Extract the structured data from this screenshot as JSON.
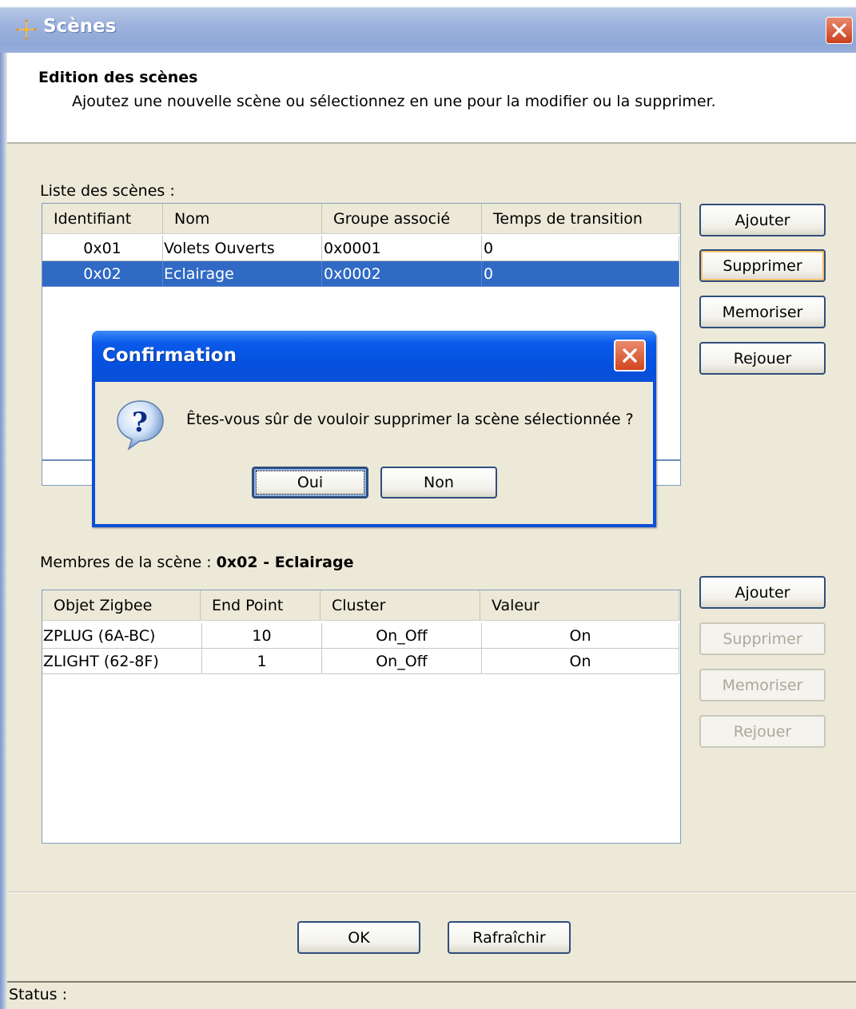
{
  "window": {
    "title": "Scènes",
    "close_icon": "close-icon"
  },
  "header": {
    "title": "Edition des scènes",
    "description": "Ajoutez une nouvelle scène ou sélectionnez en une pour la modifier ou la supprimer."
  },
  "scenes": {
    "label": "Liste des scènes :",
    "columns": [
      "Identifiant",
      "Nom",
      "Groupe associé",
      "Temps de transition"
    ],
    "rows": [
      {
        "id": "0x01",
        "name": "Volets Ouverts",
        "group": "0x0001",
        "transition": "0",
        "selected": false
      },
      {
        "id": "0x02",
        "name": "Eclairage",
        "group": "0x0002",
        "transition": "0",
        "selected": true
      }
    ],
    "buttons": {
      "add": "Ajouter",
      "delete": "Supprimer",
      "store": "Memoriser",
      "replay": "Rejouer"
    }
  },
  "members": {
    "label_prefix": "Membres de la scène : ",
    "label_scene": "0x02 - Eclairage",
    "columns": [
      "Objet Zigbee",
      "End Point",
      "Cluster",
      "Valeur"
    ],
    "rows": [
      {
        "object": "ZPLUG (6A-BC)",
        "endpoint": "10",
        "cluster": "On_Off",
        "value": "On"
      },
      {
        "object": "ZLIGHT (62-8F)",
        "endpoint": "1",
        "cluster": "On_Off",
        "value": "On"
      }
    ],
    "buttons": {
      "add": "Ajouter",
      "delete": "Supprimer",
      "store": "Memoriser",
      "replay": "Rejouer"
    }
  },
  "footer": {
    "ok": "OK",
    "refresh": "Rafraîchir"
  },
  "status": {
    "label": "Status :"
  },
  "dialog": {
    "title": "Confirmation",
    "message": "Êtes-vous sûr de vouloir supprimer la scène sélectionnée ?",
    "yes": "Oui",
    "no": "Non",
    "icon": "question-icon"
  },
  "colors": {
    "selection": "#316ac5",
    "dialog_title": "#0a4fd8",
    "background": "#ece9d8"
  }
}
